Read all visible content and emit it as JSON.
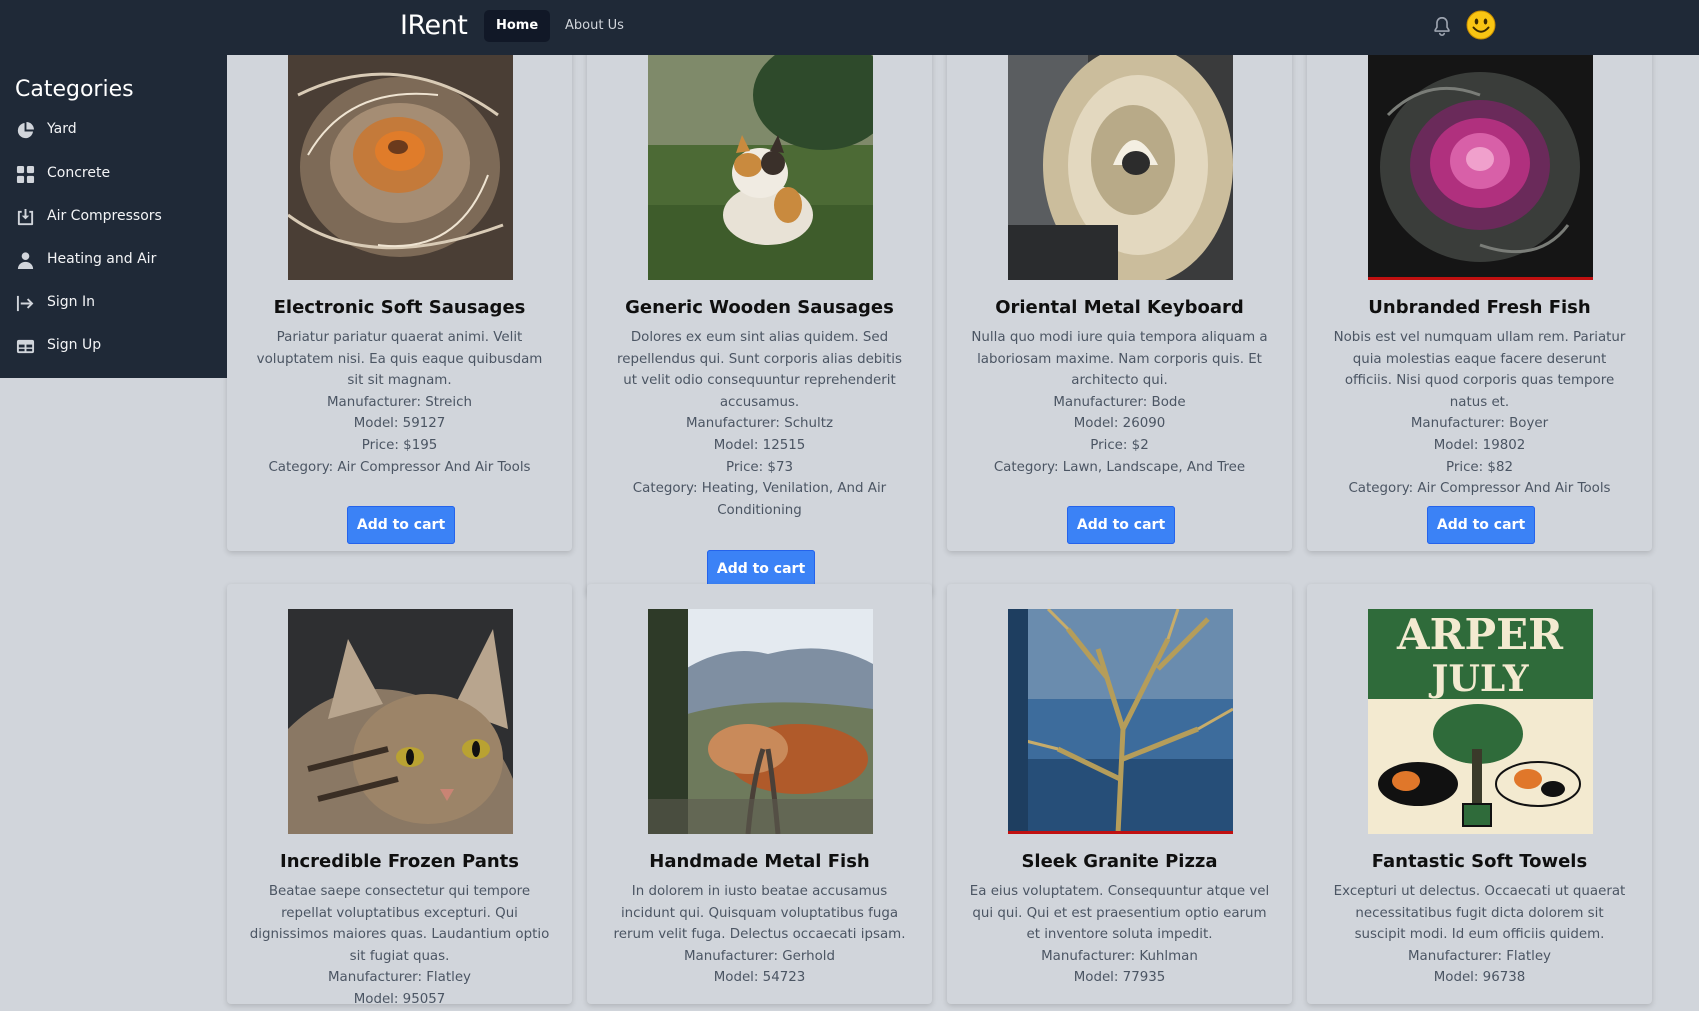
{
  "header": {
    "brand": "IRent",
    "nav": [
      {
        "label": "Home",
        "active": true
      },
      {
        "label": "About Us",
        "active": false
      }
    ],
    "icons": [
      "bell-icon",
      "smiley-avatar-icon"
    ]
  },
  "sidebar": {
    "title": "Categories",
    "items": [
      {
        "label": "Yard",
        "icon": "pie-chart-icon"
      },
      {
        "label": "Concrete",
        "icon": "grid-icon"
      },
      {
        "label": "Air Compressors",
        "icon": "download-box-icon"
      },
      {
        "label": "Heating and Air",
        "icon": "person-icon"
      },
      {
        "label": "Sign In",
        "icon": "sign-in-icon"
      },
      {
        "label": "Sign Up",
        "icon": "table-icon"
      }
    ]
  },
  "products": [
    {
      "title": "Electronic Soft Sausages",
      "description": "Pariatur pariatur quaerat animi. Velit voluptatem nisi. Ea quis eaque quibusdam sit sit magnam.",
      "manufacturer": "Manufacturer: Streich",
      "model": "Model: 59127",
      "price": "Price: $195",
      "category": "Category: Air Compressor And Air Tools",
      "button": "Add to cart",
      "image": "fractal-swirl-image"
    },
    {
      "title": "Generic Wooden Sausages",
      "description": "Dolores ex eum sint alias quidem. Sed repellendus qui. Sunt corporis alias debitis ut velit odio consequuntur reprehenderit accusamus.",
      "manufacturer": "Manufacturer: Schultz",
      "model": "Model: 12515",
      "price": "Price: $73",
      "category": "Category: Heating, Venilation, And Air Conditioning",
      "button": "Add to cart",
      "image": "calico-cat-grass-image"
    },
    {
      "title": "Oriental Metal Keyboard",
      "description": "Nulla quo modi iure quia tempora aliquam a laboriosam maxime. Nam corporis quis. Et architecto qui.",
      "manufacturer": "Manufacturer: Bode",
      "model": "Model: 26090",
      "price": "Price: $2",
      "category": "Category: Lawn, Landscape, And Tree",
      "button": "Add to cart",
      "image": "spiral-staircase-image"
    },
    {
      "title": "Unbranded Fresh Fish",
      "description": "Nobis est vel numquam ullam rem. Pariatur quia molestias eaque facere deserunt officiis. Nisi quod corporis quas tempore natus et.",
      "manufacturer": "Manufacturer: Boyer",
      "model": "Model: 19802",
      "price": "Price: $82",
      "category": "Category: Air Compressor And Air Tools",
      "button": "Add to cart",
      "image": "purple-cabbage-image"
    },
    {
      "title": "Incredible Frozen Pants",
      "description": "Beatae saepe consectetur qui tempore repellat voluptatibus excepturi. Qui dignissimos maiores quas. Laudantium optio sit fugiat quas.",
      "manufacturer": "Manufacturer: Flatley",
      "model": "Model: 95057",
      "image": "tabby-cat-closeup-image"
    },
    {
      "title": "Handmade Metal Fish",
      "description": "In dolorem in iusto beatae accusamus incidunt qui. Quisquam voluptatibus fuga rerum velit fuga. Delectus occaecati ipsam.",
      "manufacturer": "Manufacturer: Gerhold",
      "model": "Model: 54723",
      "image": "railway-hills-image"
    },
    {
      "title": "Sleek Granite Pizza",
      "description": "Ea eius voluptatem. Consequuntur atque vel qui qui. Qui et est praesentium optio earum et inventore soluta impedit.",
      "manufacturer": "Manufacturer: Kuhlman",
      "model": "Model: 77935",
      "image": "tree-window-reflection-image"
    },
    {
      "title": "Fantastic Soft Towels",
      "description": "Excepturi ut delectus. Occaecati ut quaerat necessitatibus fugit dicta dolorem sit suscipit modi. Id eum officiis quidem.",
      "manufacturer": "Manufacturer: Flatley",
      "model": "Model: 96738",
      "image": "harper-july-poster-image",
      "image_text": [
        "ARPER",
        "JULY"
      ]
    }
  ],
  "colors": {
    "topbar": "#1f2937",
    "sidebar": "#1f2937",
    "page": "#d1d5db",
    "button": "#3b82f6"
  }
}
